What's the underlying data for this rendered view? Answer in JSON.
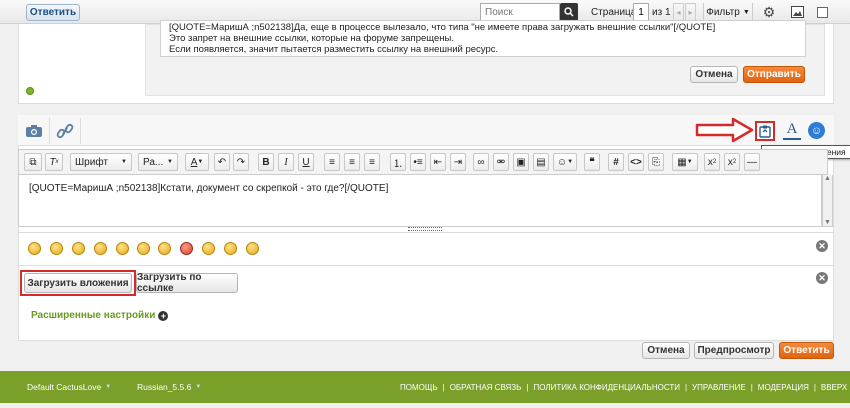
{
  "top_bar": {
    "reply_label": "Ответить",
    "search_placeholder": "Поиск",
    "page_label": "Страница",
    "page_current": "1",
    "page_of": "из 1",
    "filter_label": "Фильтр"
  },
  "quoted_text": {
    "line1": "[QUOTE=МаришА ;n502138]Да, еще в процессе вылезало, что типа \"не имеете права загружать внешние ссылки\"[/QUOTE]",
    "line2": "Это запрет на внешние ссылки, которые на форуме запрещены.",
    "line3": "Если появляется, значит пытается разместить ссылку на внешний ресурс."
  },
  "top_actions": {
    "cancel_label": "Отмена",
    "send_label": "Отправить"
  },
  "editor": {
    "font_label": "Шрифт",
    "size_label": "Ра...",
    "tooltip": "Загрузить вложения",
    "content": "[QUOTE=МаришА ;n502138]Кстати, документ со скрепкой - это где?[/QUOTE]"
  },
  "attachments": {
    "upload_label": "Загрузить вложения",
    "upload_link_label": "Загрузить по ссылке",
    "advanced_label": "Расширенные настройки"
  },
  "bottom_actions": {
    "cancel_label": "Отмена",
    "preview_label": "Предпросмотр",
    "reply_label": "Ответить"
  },
  "footer": {
    "style_label": "Default CactusLove",
    "lang_label": "Russian_5.5.6",
    "links": [
      "ПОМОЩЬ",
      "ОБРАТНАЯ СВЯЗЬ",
      "ПОЛИТИКА КОНФИДЕНЦИАЛЬНОСТИ",
      "УПРАВЛЕНИЕ",
      "МОДЕРАЦИЯ",
      "ВВЕРХ"
    ]
  },
  "colors": {
    "accent_orange": "#e06410",
    "footer_green": "#7aa02a",
    "annotation_red": "#d42a2a",
    "link_green": "#6a9a1f"
  }
}
